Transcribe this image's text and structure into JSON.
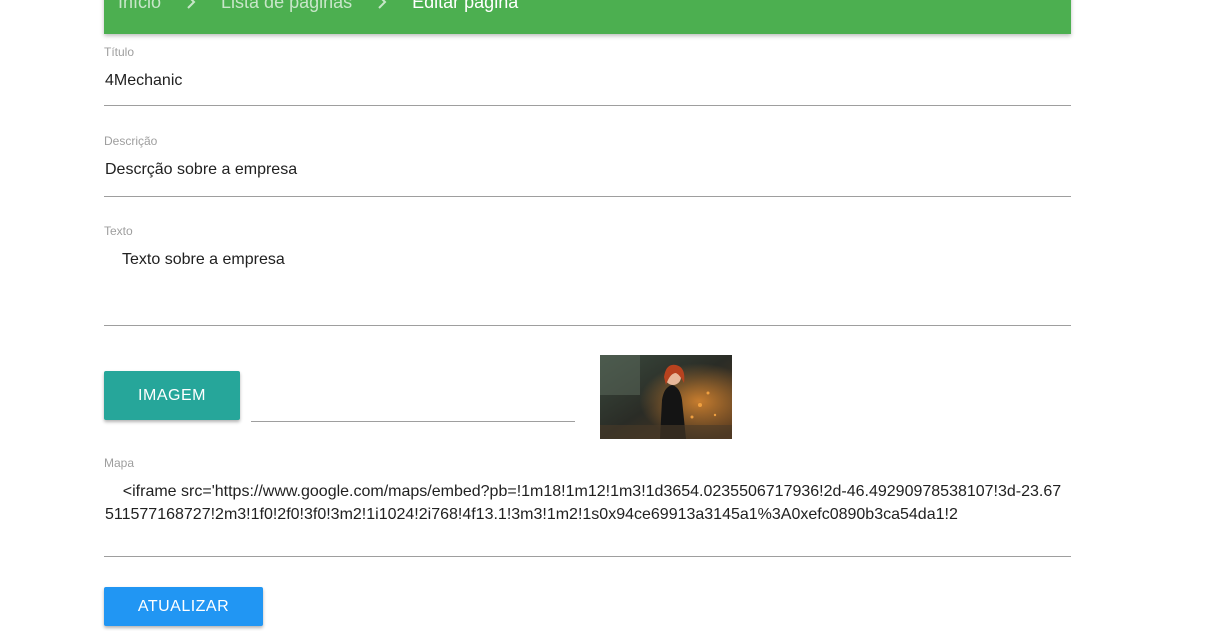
{
  "breadcrumb": {
    "items": [
      "Início",
      "Lista de páginas",
      "Editar página"
    ],
    "separator_icon": "chevron-right-icon",
    "bar_color": "#4caf50"
  },
  "form": {
    "titulo": {
      "label": "Título",
      "value": "4Mechanic"
    },
    "descricao": {
      "label": "Descrição",
      "value": "Descrção sobre a empresa"
    },
    "texto": {
      "label": "Texto",
      "value": "Texto sobre a empresa"
    },
    "imagem": {
      "button_label": "IMAGEM",
      "file_path_value": "",
      "button_color": "#26a69a"
    },
    "mapa": {
      "label": "Mapa",
      "value": "    <iframe src='https://www.google.com/maps/embed?pb=!1m18!1m12!1m3!1d3654.0235506717936!2d-46.49290978538107!3d-23.67511577168727!2m3!1f0!2f0!3f0!3m2!1i1024!2i768!4f13.1!3m3!1m2!1s0x94ce69913a3145a1%3A0xefc0890b3ca54da1!2"
    },
    "submit": {
      "label": "ATUALIZAR",
      "button_color": "#2196f3"
    }
  }
}
